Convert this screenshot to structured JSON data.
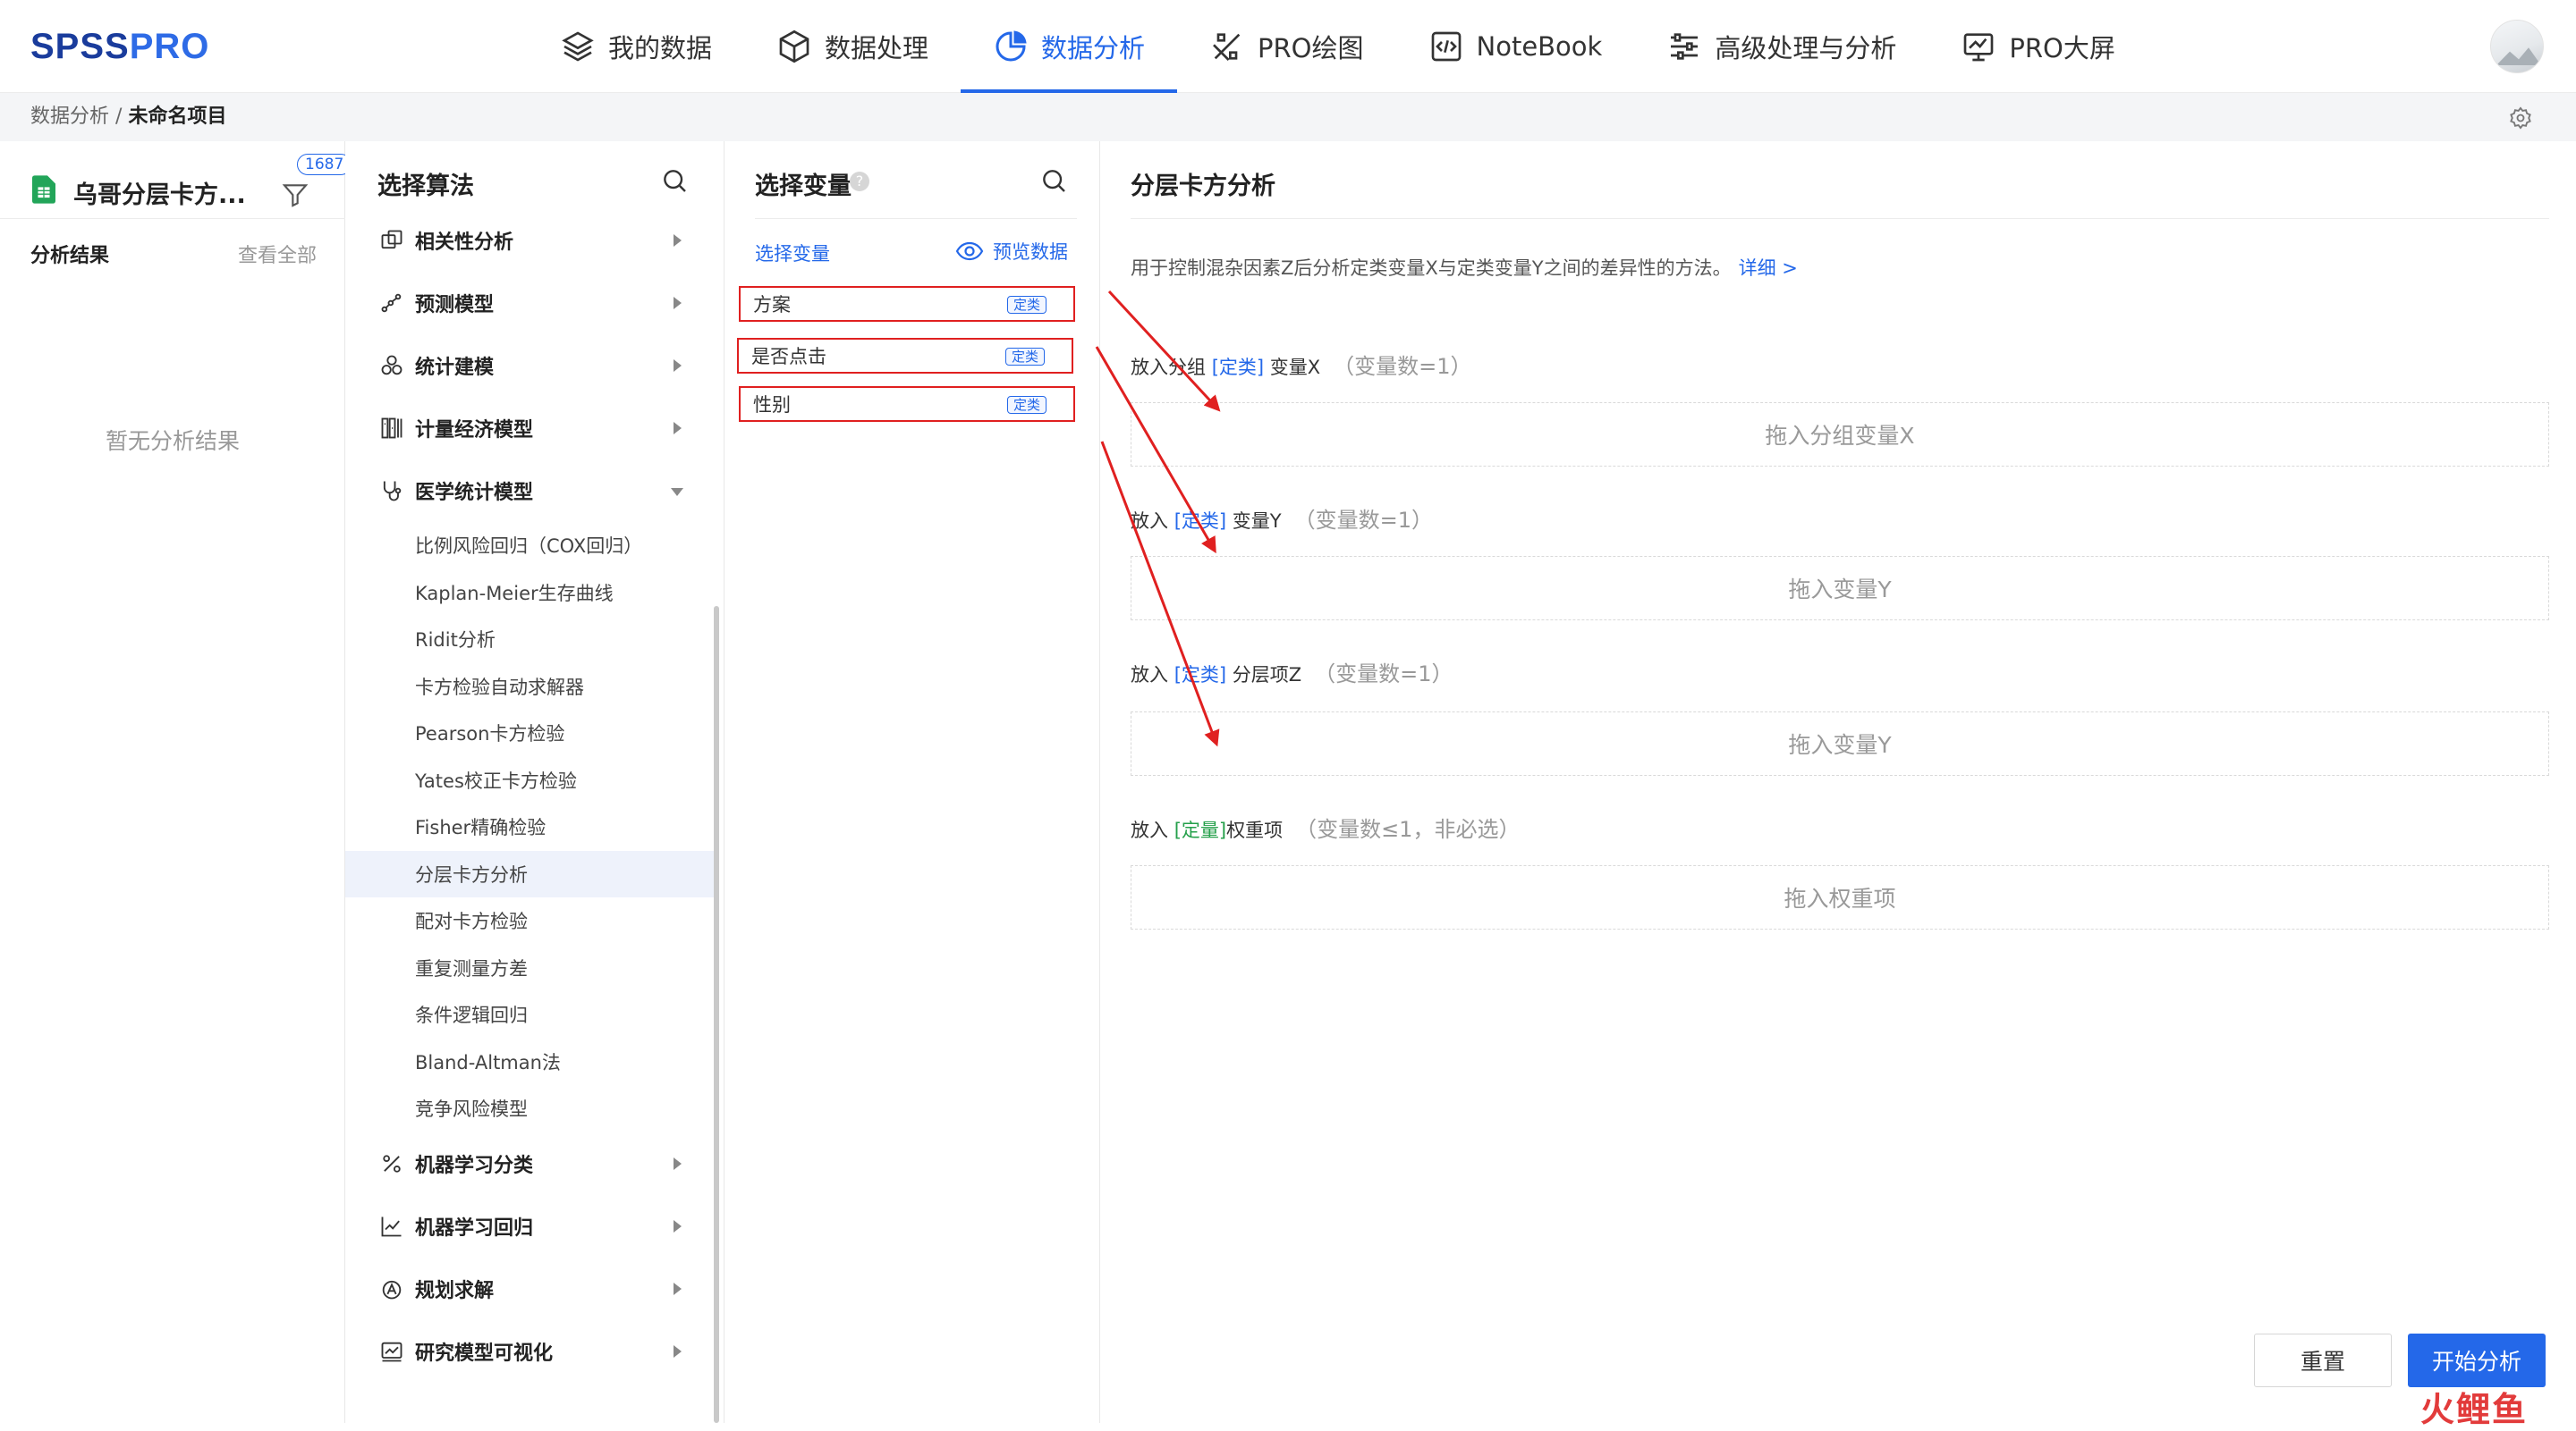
{
  "brand": {
    "part1": "SPSS",
    "part2": "PRO"
  },
  "nav": [
    {
      "label": "我的数据",
      "icon": "layers-icon"
    },
    {
      "label": "数据处理",
      "icon": "cube-icon"
    },
    {
      "label": "数据分析",
      "icon": "pie-chart-icon",
      "active": true
    },
    {
      "label": "PRO绘图",
      "icon": "pen-tool-icon"
    },
    {
      "label": "NoteBook",
      "icon": "code-icon"
    },
    {
      "label": "高级处理与分析",
      "icon": "sliders-icon"
    },
    {
      "label": "PRO大屏",
      "icon": "monitor-chart-icon"
    }
  ],
  "breadcrumb": {
    "parent": "数据分析",
    "sep": "/",
    "current": "未命名项目"
  },
  "left": {
    "file_name": "乌哥分层卡方...",
    "badge": "1687",
    "results_title": "分析结果",
    "view_all": "查看全部",
    "empty": "暂无分析结果"
  },
  "algo": {
    "title": "选择算法",
    "categories_top": [
      {
        "label": "相关性分析",
        "icon": "correlation-icon"
      },
      {
        "label": "预测模型",
        "icon": "trend-icon"
      },
      {
        "label": "统计建模",
        "icon": "circles-icon"
      },
      {
        "label": "计量经济模型",
        "icon": "econometric-icon"
      },
      {
        "label": "医学统计模型",
        "icon": "stethoscope-icon",
        "expanded": true
      }
    ],
    "medical_items": [
      "比例风险回归（COX回归）",
      "Kaplan-Meier生存曲线",
      "Ridit分析",
      "卡方检验自动求解器",
      "Pearson卡方检验",
      "Yates校正卡方检验",
      "Fisher精确检验",
      "分层卡方分析",
      "配对卡方检验",
      "重复测量方差",
      "条件逻辑回归",
      "Bland-Altman法",
      "竞争风险模型"
    ],
    "active_index": 7,
    "categories_bottom": [
      {
        "label": "机器学习分类",
        "icon": "percent-icon"
      },
      {
        "label": "机器学习回归",
        "icon": "line-chart-icon"
      },
      {
        "label": "规划求解",
        "icon": "planning-icon"
      },
      {
        "label": "研究模型可视化",
        "icon": "model-visual-icon"
      }
    ]
  },
  "vars": {
    "title": "选择变量",
    "help": "?",
    "link": "选择变量",
    "preview": "预览数据",
    "items": [
      {
        "name": "方案",
        "tag": "定类"
      },
      {
        "name": "是否点击",
        "tag": "定类"
      },
      {
        "name": "性别",
        "tag": "定类"
      }
    ]
  },
  "main": {
    "title": "分层卡方分析",
    "description": "用于控制混杂因素Z后分析定类变量X与定类变量Y之间的差异性的方法。",
    "detail_link": "详细 >",
    "slots": [
      {
        "pre": "放入分组 ",
        "type": "[定类]",
        "post": " 变量X",
        "count": "（变量数=1）",
        "placeholder": "拖入分组变量X"
      },
      {
        "pre": "放入 ",
        "type": "[定类]",
        "post": " 变量Y",
        "count": "（变量数=1）",
        "placeholder": "拖入变量Y"
      },
      {
        "pre": "放入 ",
        "type": "[定类]",
        "post": " 分层项Z",
        "count": "（变量数=1）",
        "placeholder": "拖入变量Y"
      },
      {
        "pre": "放入 ",
        "type": "[定量]",
        "post": "权重项",
        "count": "（变量数≤1，非必选）",
        "placeholder": "拖入权重项"
      }
    ],
    "reset": "重置",
    "start": "开始分析"
  },
  "watermark": "火鲤鱼",
  "colors": {
    "accent": "#2468e9",
    "annotation": "#e02020",
    "quant": "#25a04b"
  }
}
